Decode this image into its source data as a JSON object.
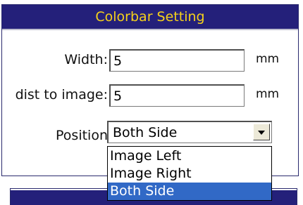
{
  "colorbar": {
    "title": "Colorbar Setting",
    "width_label": "Width:",
    "width_value": "5",
    "width_unit": "mm",
    "dist_label": "dist to image:",
    "dist_value": "5",
    "dist_unit": "mm",
    "position_label": "Position",
    "position_value": "Both Side",
    "position_options": [
      "Image Left",
      "Image Right",
      "Both Side"
    ],
    "position_selected_index": 2
  },
  "colors": {
    "header_bg": "#24207a",
    "header_text": "#f6d21a",
    "selection_bg": "#3169c6"
  }
}
